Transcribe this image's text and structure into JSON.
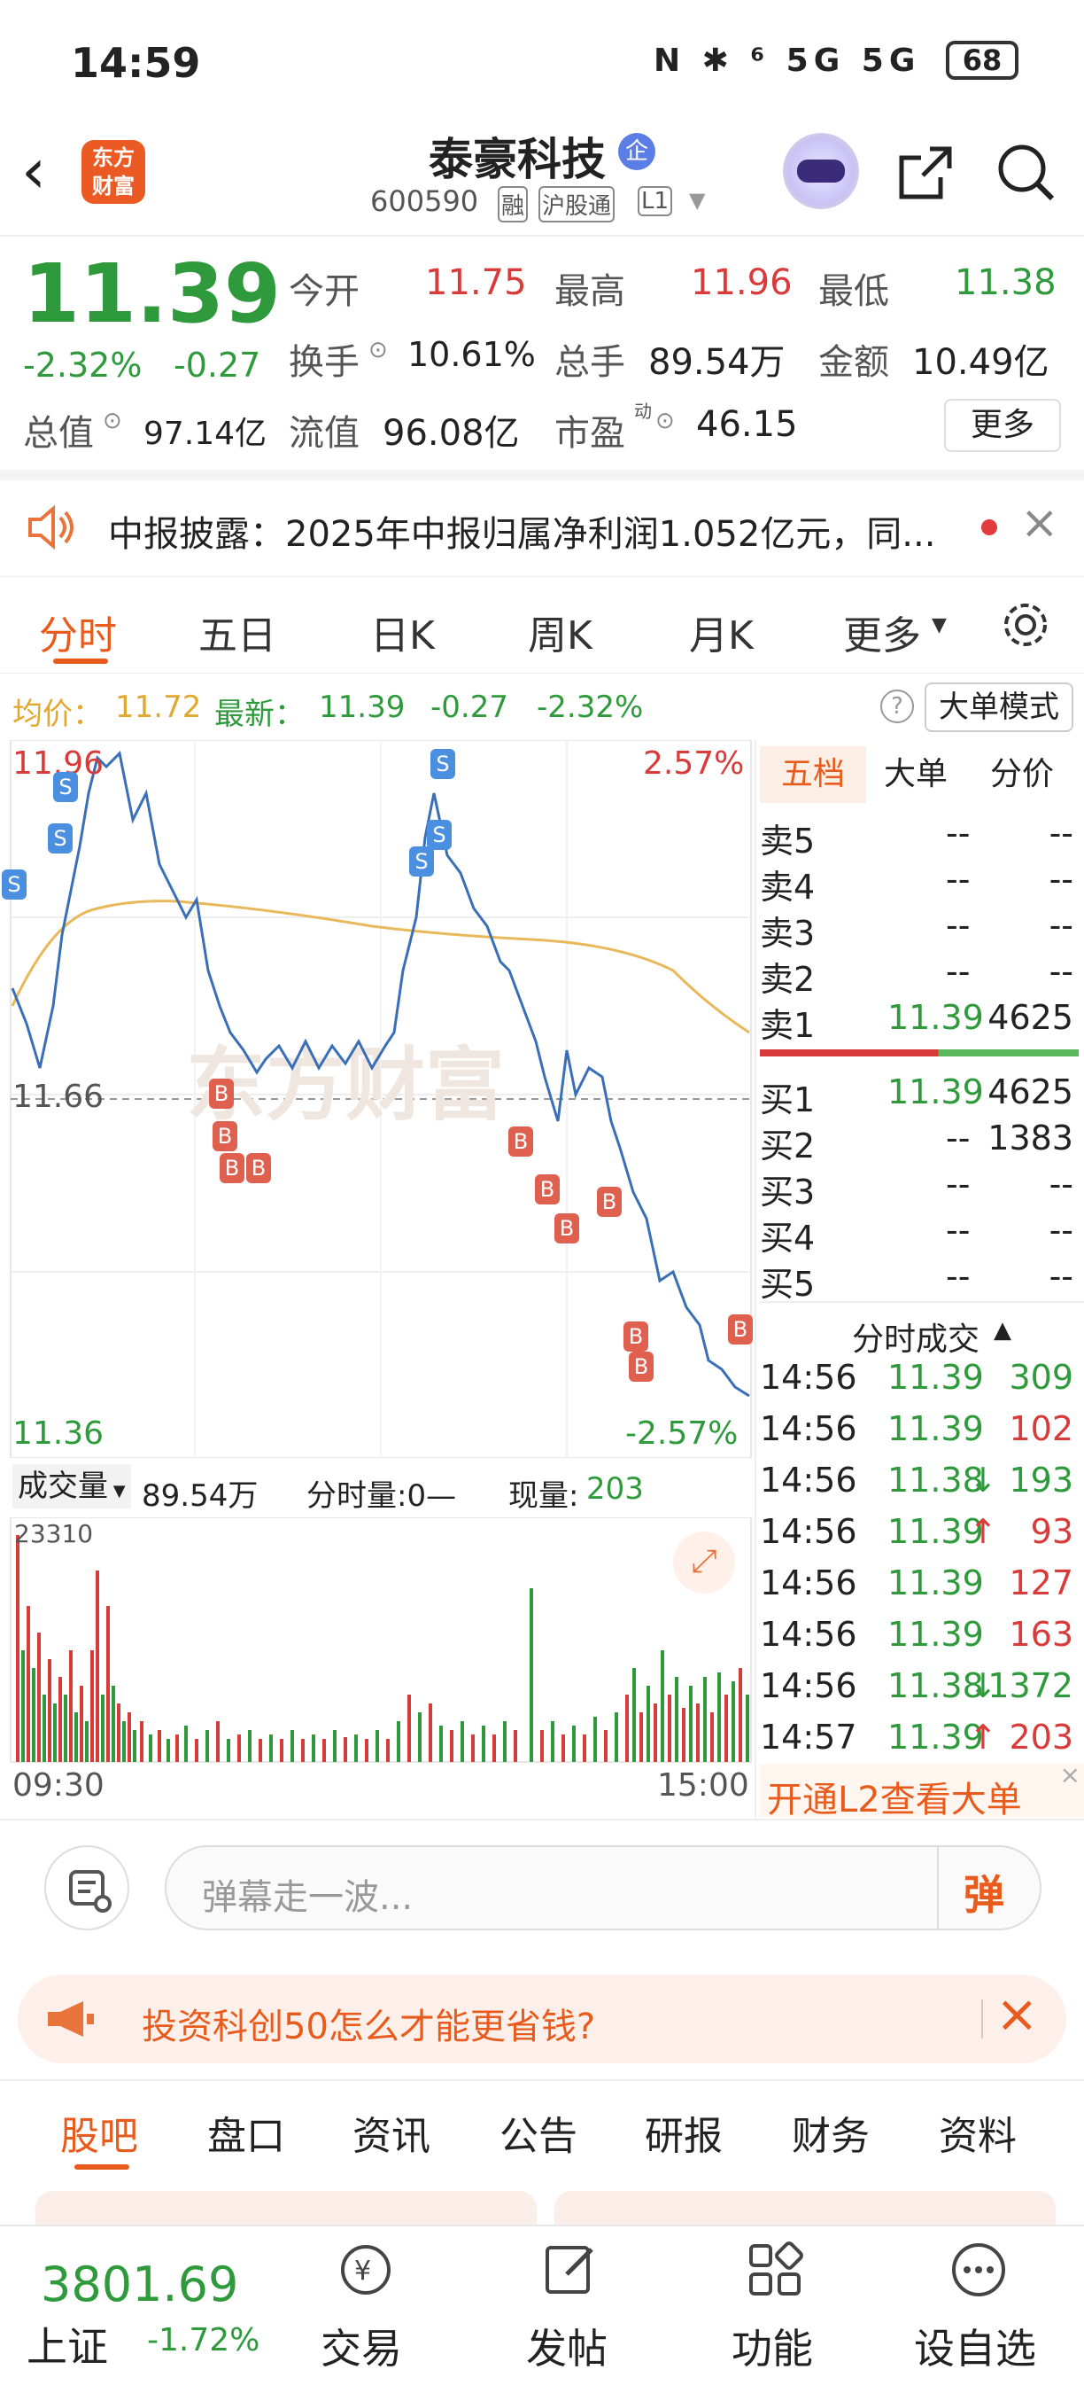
{
  "statusbar": {
    "time": "14:59",
    "icons": "N ✱ ⁶ 5G 5G",
    "battery": "68"
  },
  "header": {
    "title": "泰豪科技",
    "badge": "企",
    "code": "600590",
    "tags": [
      "融",
      "沪股通",
      "L1"
    ]
  },
  "quote": {
    "price": "11.39",
    "change_pct": "-2.32%",
    "change": "-0.27",
    "open_label": "今开",
    "open": "11.75",
    "high_label": "最高",
    "high": "11.96",
    "low_label": "最低",
    "low": "11.38",
    "turnover_label": "换手",
    "turnover": "10.61%",
    "volume_label": "总手",
    "volume": "89.54万",
    "amount_label": "金额",
    "amount": "10.49亿",
    "mktcap_label": "总值",
    "mktcap": "97.14亿",
    "float_label": "流值",
    "float": "96.08亿",
    "pe_label": "市盈",
    "pe_sup": "动",
    "pe": "46.15",
    "more_button": "更多"
  },
  "notice": {
    "text": "中报披露：2025年中报归属净利润1.052亿元，同..."
  },
  "tabs": [
    "分时",
    "五日",
    "日K",
    "周K",
    "月K",
    "更多"
  ],
  "info_line": {
    "avg_label": "均价：",
    "avg": "11.72",
    "latest_label": "最新：",
    "latest": "11.39",
    "chg": "-0.27",
    "chg_pct": "-2.32%",
    "mode_button": "大单模式"
  },
  "chart_labels": {
    "top_left": "11.96",
    "top_right": "2.57%",
    "mid": "11.66",
    "bottom_left": "11.36",
    "bottom_right": "-2.57%",
    "watermark": "东方财富"
  },
  "volume_bar": {
    "label": "成交量",
    "total": "89.54万",
    "split_label": "分时量:0—",
    "now_label": "现量:",
    "now": "203",
    "max": "23310",
    "start": "09:30",
    "end": "15:00"
  },
  "orderbook": {
    "tabs": [
      "五档",
      "大单",
      "分价"
    ],
    "asks": [
      {
        "label": "卖5",
        "price": "--",
        "vol": "--"
      },
      {
        "label": "卖4",
        "price": "--",
        "vol": "--"
      },
      {
        "label": "卖3",
        "price": "--",
        "vol": "--"
      },
      {
        "label": "卖2",
        "price": "--",
        "vol": "--"
      },
      {
        "label": "卖1",
        "price": "11.39",
        "vol": "4625"
      }
    ],
    "bids": [
      {
        "label": "买1",
        "price": "11.39",
        "vol": "4625"
      },
      {
        "label": "买2",
        "price": "--",
        "vol": "1383"
      },
      {
        "label": "买3",
        "price": "--",
        "vol": "--"
      },
      {
        "label": "买4",
        "price": "--",
        "vol": "--"
      },
      {
        "label": "买5",
        "price": "--",
        "vol": "--"
      }
    ]
  },
  "trades": {
    "title": "分时成交",
    "rows": [
      {
        "time": "14:56",
        "price": "11.39",
        "arrow": "",
        "vol": "309",
        "color": "green"
      },
      {
        "time": "14:56",
        "price": "11.39",
        "arrow": "",
        "vol": "102",
        "color": "red"
      },
      {
        "time": "14:56",
        "price": "11.38",
        "arrow": "↓",
        "vol": "193",
        "color": "green"
      },
      {
        "time": "14:56",
        "price": "11.39",
        "arrow": "↑",
        "vol": "93",
        "color": "red"
      },
      {
        "time": "14:56",
        "price": "11.39",
        "arrow": "",
        "vol": "127",
        "color": "red"
      },
      {
        "time": "14:56",
        "price": "11.39",
        "arrow": "",
        "vol": "163",
        "color": "red"
      },
      {
        "time": "14:56",
        "price": "11.38",
        "arrow": "↓",
        "vol": "1372",
        "color": "green"
      },
      {
        "time": "14:57",
        "price": "11.39",
        "arrow": "↑",
        "vol": "203",
        "color": "red"
      }
    ],
    "l2_link": "开通L2查看大单"
  },
  "danmaku": {
    "placeholder": "弹幕走一波...",
    "button": "弹"
  },
  "promo": {
    "text": "投资科创50怎么才能更省钱?"
  },
  "subtabs": [
    "股吧",
    "盘口",
    "资讯",
    "公告",
    "研报",
    "财务",
    "资料"
  ],
  "bottom": {
    "index_value": "3801.69",
    "index_name": "上证",
    "index_chg": "-1.72%",
    "items": [
      "交易",
      "发帖",
      "功能",
      "设自选"
    ]
  }
}
